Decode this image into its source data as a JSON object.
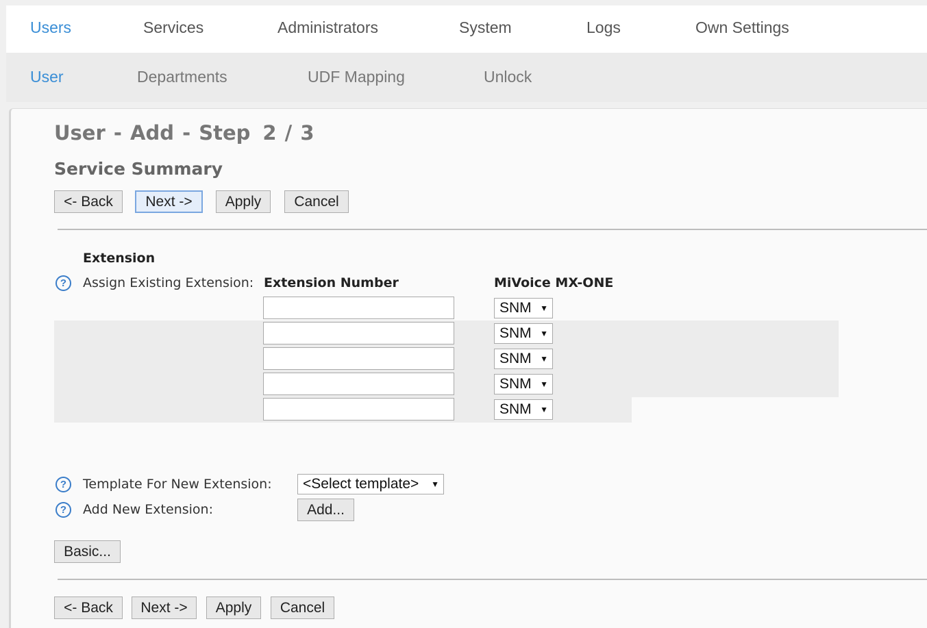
{
  "top_nav": {
    "items": [
      {
        "label": "Users",
        "active": true
      },
      {
        "label": "Services",
        "active": false
      },
      {
        "label": "Administrators",
        "active": false
      },
      {
        "label": "System",
        "active": false
      },
      {
        "label": "Logs",
        "active": false
      },
      {
        "label": "Own Settings",
        "active": false
      }
    ]
  },
  "sub_nav": {
    "items": [
      {
        "label": "User",
        "active": true
      },
      {
        "label": "Departments",
        "active": false
      },
      {
        "label": "UDF Mapping",
        "active": false
      },
      {
        "label": "Unlock",
        "active": false
      }
    ]
  },
  "page": {
    "title": "User - Add - Step",
    "step": "2 / 3",
    "section_title": "Service Summary"
  },
  "actions": {
    "back": "<- Back",
    "next": "Next ->",
    "apply": "Apply",
    "cancel": "Cancel"
  },
  "extension": {
    "heading": "Extension",
    "assign_label": "Assign Existing Extension:",
    "col_number": "Extension Number",
    "col_system": "MiVoice MX-ONE",
    "rows": [
      {
        "number": "",
        "system": "SNM"
      },
      {
        "number": "",
        "system": "SNM"
      },
      {
        "number": "",
        "system": "SNM"
      },
      {
        "number": "",
        "system": "SNM"
      },
      {
        "number": "",
        "system": "SNM"
      }
    ],
    "template_label": "Template For New Extension:",
    "template_value": "<Select template>",
    "add_label": "Add New Extension:",
    "add_button": "Add..."
  },
  "basic_button": "Basic...",
  "help_icon_glyph": "?",
  "dropdown_glyph": "▼",
  "colors": {
    "accent": "#3a8ed6",
    "background": "#f0f0f0"
  }
}
